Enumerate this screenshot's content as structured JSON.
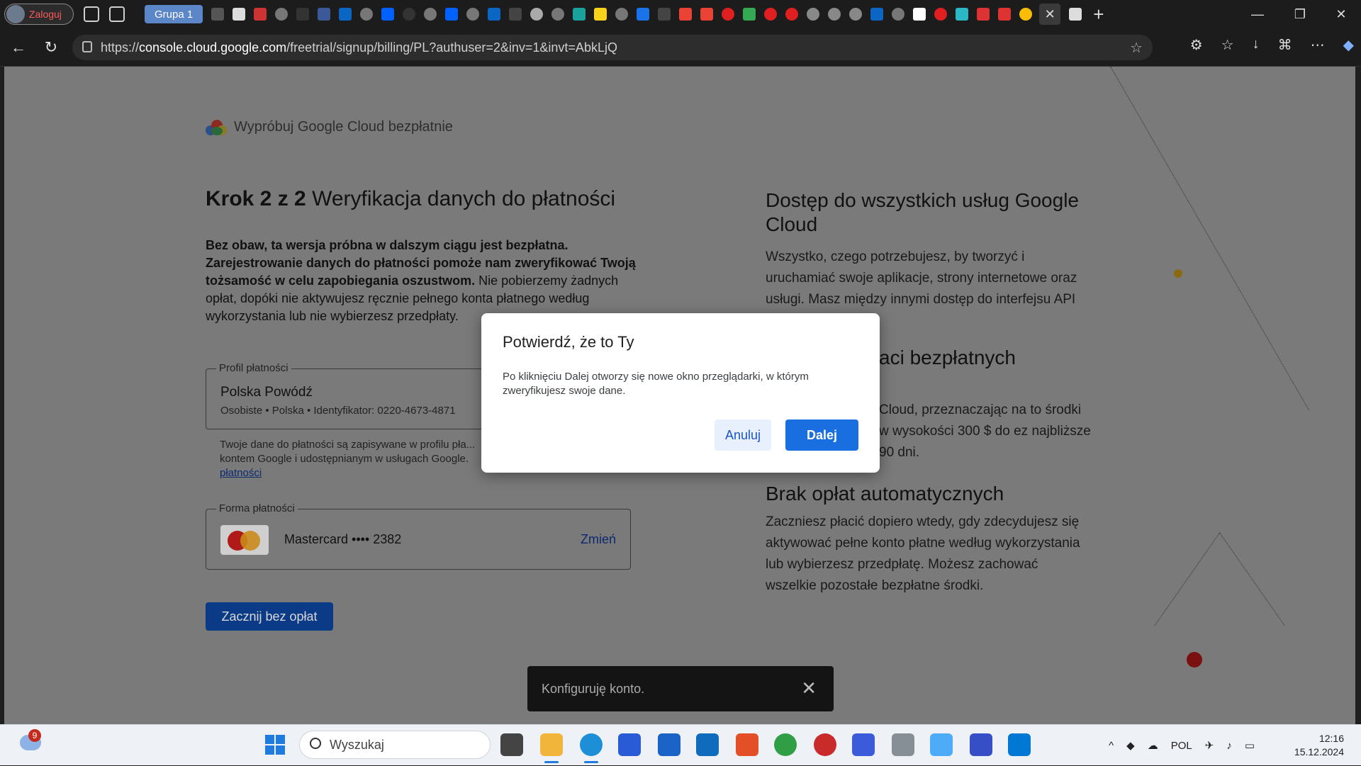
{
  "browser": {
    "profile_label": "Zaloguj",
    "tab_group_label": "Grupa 1",
    "url_prefix": "https://",
    "url_domain": "console.cloud.google.com",
    "url_path": "/freetrial/signup/billing/PL?authuser=2&inv=1&invt=AbkLjQ"
  },
  "page": {
    "header_title": "Wypróbuj Google Cloud bezpłatnie",
    "step_bold": "Krok 2 z 2",
    "step_title": "Weryfikacja danych do płatności",
    "intro_bold": "Bez obaw, ta wersja próbna w dalszym ciągu jest bezpłatna. Zarejestrowanie danych do płatności pomoże nam zweryfikować Twoją tożsamość w celu zapobiegania oszustwom.",
    "intro_rest": " Nie pobierzemy żadnych opłat, dopóki nie aktywujesz ręcznie pełnego konta płatnego według wykorzystania lub nie wybierzesz przedpłaty.",
    "billing_profile_legend": "Profil płatności",
    "billing_profile_name": "Polska Powódź",
    "billing_profile_details": "Osobiste • Polska • Identyfikator: 0220-4673-4871",
    "note_text": "Twoje dane do płatności są zapisywane w profilu pła... kontem Google i udostępnianym w usługach Google.",
    "note_link": "płatności",
    "payment_legend": "Forma płatności",
    "payment_card": "Mastercard •••• 2382",
    "payment_change": "Zmień",
    "start_button": "Zacznij bez opłat",
    "right_h1": "Dostęp do wszystkich usług Google Cloud",
    "right_p1": "Wszystko, czego potrzebujesz, by tworzyć i uruchamiać swoje aplikacje, strony internetowe oraz usługi. Masz między innymi dostęp do interfejsu API Map Google.",
    "right_h2_visible": "aci bezpłatnych",
    "right_p2_visible": "Cloud, przeznaczając na to środki w wysokości 300 $ do ez najbliższe 90 dni.",
    "right_h3": "Brak opłat automatycznych",
    "right_p3": "Zaczniesz płacić dopiero wtedy, gdy zdecydujesz się aktywować pełne konto płatne według wykorzystania lub wybierzesz przedpłatę. Możesz zachować wszelkie pozostałe bezpłatne środki."
  },
  "dialog": {
    "title": "Potwierdź, że to Ty",
    "body": "Po kliknięciu Dalej otworzy się nowe okno przeglądarki, w którym zweryfikujesz swoje dane.",
    "cancel": "Anuluj",
    "next": "Dalej"
  },
  "snackbar": {
    "text": "Konfiguruję konto."
  },
  "taskbar": {
    "notification_count": "9",
    "search_placeholder": "Wyszukaj",
    "language": "POL",
    "time": "12:16",
    "date": "15.12.2024"
  },
  "colors": {
    "accent_blue": "#1a6fe0",
    "overlay_gray": "#7a7a7a",
    "dark_link": "#0b2a6e"
  }
}
